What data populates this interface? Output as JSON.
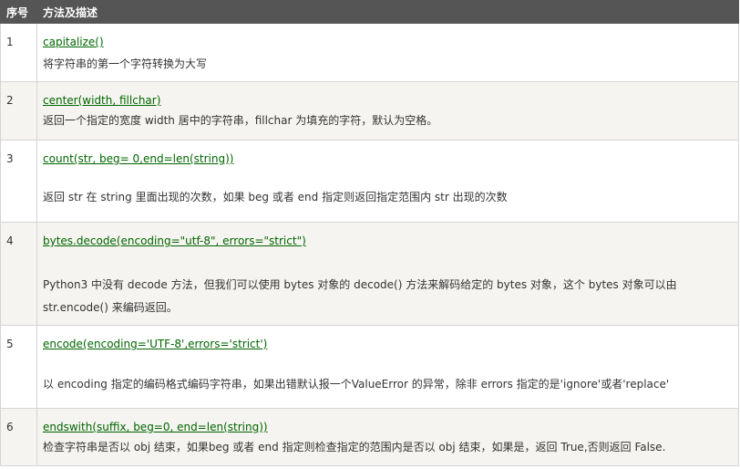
{
  "header": {
    "col_num": "序号",
    "col_desc": "方法及描述"
  },
  "rows": [
    {
      "num": "1",
      "method": "capitalize()",
      "desc": "将字符串的第一个字符转换为大写"
    },
    {
      "num": "2",
      "method": "center(width, fillchar)",
      "desc": "返回一个指定的宽度 width 居中的字符串，fillchar 为填充的字符，默认为空格。"
    },
    {
      "num": "3",
      "method": "count(str, beg= 0,end=len(string))",
      "desc": "返回 str 在 string 里面出现的次数，如果 beg 或者 end 指定则返回指定范围内 str 出现的次数"
    },
    {
      "num": "4",
      "method": "bytes.decode(encoding=\"utf-8\", errors=\"strict\")",
      "desc": "Python3 中没有 decode 方法，但我们可以使用 bytes 对象的 decode() 方法来解码给定的 bytes 对象，这个 bytes 对象可以由 str.encode() 来编码返回。"
    },
    {
      "num": "5",
      "method": "encode(encoding='UTF-8',errors='strict')",
      "desc": "以 encoding 指定的编码格式编码字符串，如果出错默认报一个ValueError 的异常，除非 errors 指定的是'ignore'或者'replace'"
    },
    {
      "num": "6",
      "method": "endswith(suffix, beg=0, end=len(string))",
      "desc": "检查字符串是否以 obj 结束，如果beg 或者 end 指定则检查指定的范围内是否以 obj 结束，如果是，返回 True,否则返回 False."
    }
  ]
}
